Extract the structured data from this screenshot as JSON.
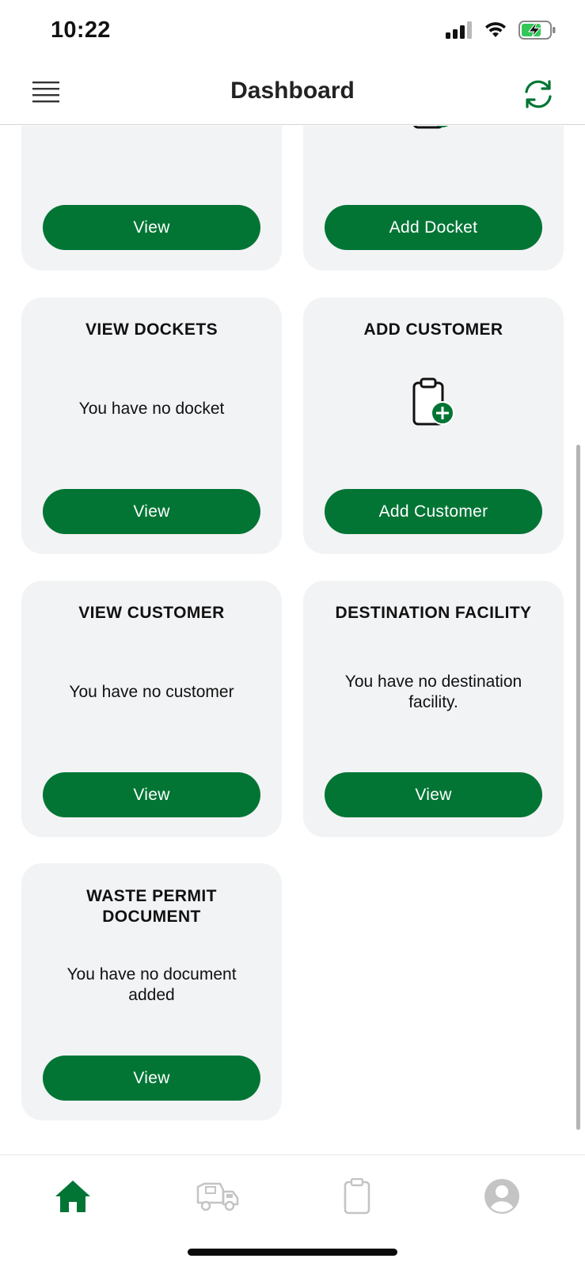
{
  "status_bar": {
    "time": "10:22"
  },
  "header": {
    "title": "Dashboard"
  },
  "colors": {
    "brand_green": "#027535",
    "card_bg": "#f2f3f5"
  },
  "cards": {
    "top_left": {
      "button": "View"
    },
    "top_right": {
      "button": "Add Docket"
    },
    "view_dockets": {
      "title": "VIEW DOCKETS",
      "text": "You have no docket",
      "button": "View"
    },
    "add_customer": {
      "title": "ADD CUSTOMER",
      "icon": "clipboard-plus-icon",
      "button": "Add Customer"
    },
    "view_customer": {
      "title": "VIEW CUSTOMER",
      "text": "You have no customer",
      "button": "View"
    },
    "destination_facility": {
      "title": "DESTINATION FACILITY",
      "text": "You have no destination facility.",
      "button": "View"
    },
    "waste_permit": {
      "title": "WASTE PERMIT DOCUMENT",
      "text": "You have no document added",
      "button": "View"
    }
  },
  "bottom_nav": [
    {
      "icon": "home-icon",
      "active": true
    },
    {
      "icon": "truck-icon",
      "active": false
    },
    {
      "icon": "clipboard-icon",
      "active": false
    },
    {
      "icon": "profile-icon",
      "active": false
    }
  ]
}
